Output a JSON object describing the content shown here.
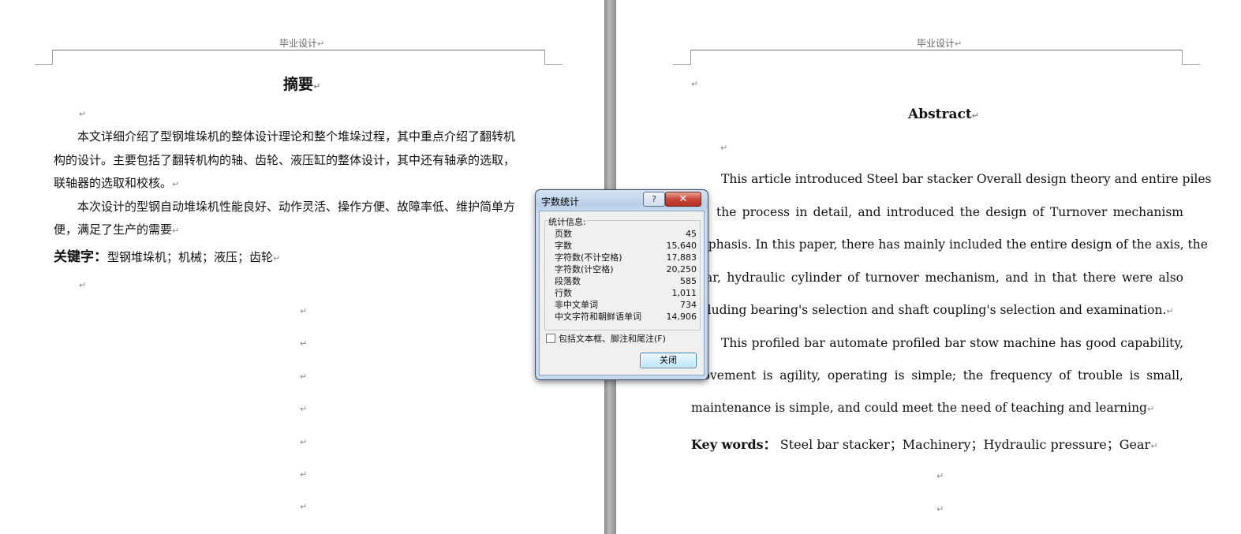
{
  "header": {
    "left": "毕业设计",
    "right": "毕业设计"
  },
  "paragraph_mark": "↵",
  "left_page": {
    "title": "摘要",
    "lines": [
      "本文详细介绍了型钢堆垛机的整体设计理论和整个堆垛过程，其中重点介绍了翻转机",
      "构的设计。主要包括了翻转机构的轴、齿轮、液压缸的整体设计，其中还有轴承的选取，",
      "联轴器的选取和校核。",
      "本次设计的型钢自动堆垛机性能良好、动作灵活、操作方便、故障率低、维护简单方",
      "便，满足了生产的需要"
    ],
    "keywords_label": "关键字：",
    "keywords": "型钢堆垛机；机械；液压；齿轮"
  },
  "right_page": {
    "title": "Abstract",
    "lines": [
      "This article introduced Steel bar stacker Overall design theory and entire piles",
      "the process in detail, and introduced the design of Turnover mechanism",
      "mphasis. In this paper, there has mainly included the entire design of the axis, the",
      "ar, hydraulic cylinder of turnover mechanism, and in that there were also",
      "cluding bearing's selection and shaft coupling's selection and examination.",
      "This profiled bar automate profiled bar stow machine has good capability,",
      "movement is agility, operating is simple; the frequency of trouble is small,",
      "maintenance is simple, and could meet the need of teaching and learning"
    ],
    "keywords_label": "Key words：",
    "keywords": "Steel bar stacker；Machinery；Hydraulic pressure；Gear"
  },
  "dialog": {
    "title": "字数统计",
    "help_label": "?",
    "close_x": "✕",
    "group_label": "统计信息:",
    "stats": [
      {
        "label": "页数",
        "value": "45"
      },
      {
        "label": "字数",
        "value": "15,640"
      },
      {
        "label": "字符数(不计空格)",
        "value": "17,883"
      },
      {
        "label": "字符数(计空格)",
        "value": "20,250"
      },
      {
        "label": "段落数",
        "value": "585"
      },
      {
        "label": "行数",
        "value": "1,011"
      },
      {
        "label": "非中文单词",
        "value": "734"
      },
      {
        "label": "中文字符和朝鲜语单词",
        "value": "14,906"
      }
    ],
    "checkbox_label": "包括文本框、脚注和尾注(F)",
    "checkbox_checked": false,
    "close_button": "关闭"
  }
}
